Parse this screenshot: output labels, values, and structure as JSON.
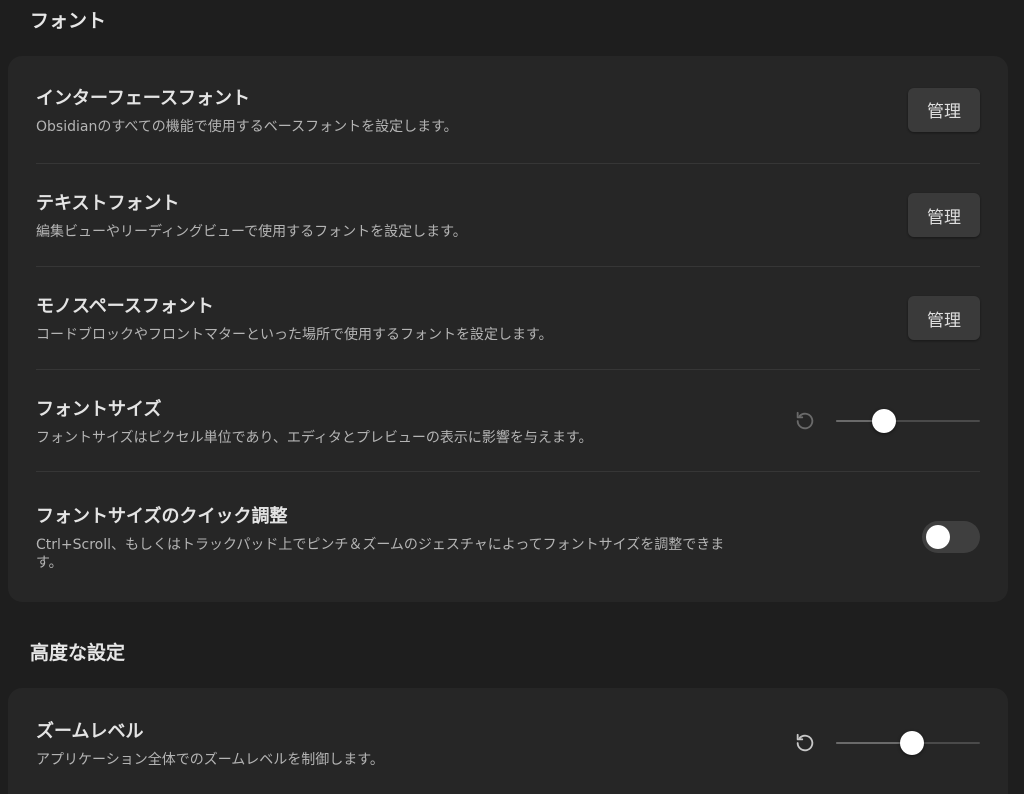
{
  "sections": {
    "font": {
      "heading": "フォント",
      "settings": [
        {
          "name": "インターフェースフォント",
          "desc": "Obsidianのすべての機能で使用するベースフォントを設定します。",
          "button": "管理"
        },
        {
          "name": "テキストフォント",
          "desc": "編集ビューやリーディングビューで使用するフォントを設定します。",
          "button": "管理"
        },
        {
          "name": "モノスペースフォント",
          "desc": "コードブロックやフロントマターといった場所で使用するフォントを設定します。",
          "button": "管理"
        },
        {
          "name": "フォントサイズ",
          "desc": "フォントサイズはピクセル単位であり、エディタとプレビューの表示に影響を与えます。",
          "slider_value": 0.33,
          "reset_icon": "reset-icon"
        },
        {
          "name": "フォントサイズのクイック調整",
          "desc_line1": "Ctrl+Scroll、もしくはトラックパッド上でピンチ＆ズームのジェスチャによってフォントサイズを調整できま",
          "desc_line2": "す。",
          "toggle_on": false
        }
      ]
    },
    "advanced": {
      "heading": "高度な設定",
      "settings": [
        {
          "name": "ズームレベル",
          "desc": "アプリケーション全体でのズームレベルを制御します。",
          "slider_value": 0.53,
          "reset_icon": "reset-icon"
        }
      ]
    }
  },
  "colors": {
    "background": "#1e1e1e",
    "card": "#262626",
    "button": "#3a3a3a",
    "toggle_off": "#3f3f3f",
    "thumb": "#ffffff"
  }
}
